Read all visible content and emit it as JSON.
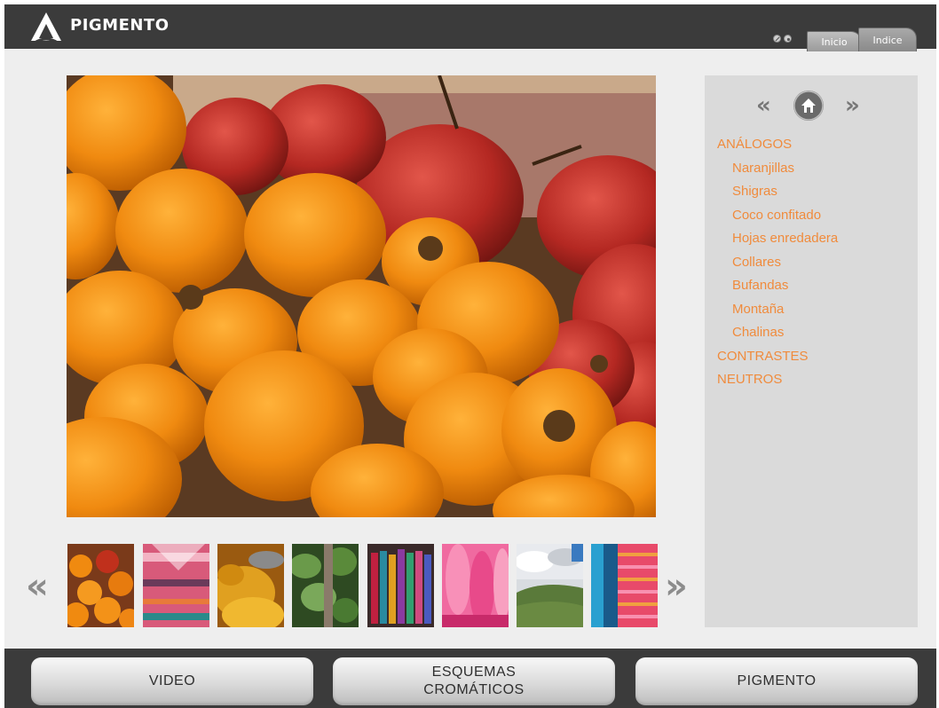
{
  "app": {
    "title": "PIGMENTO",
    "brand_color": "#f08b3c"
  },
  "header": {
    "tabs": [
      {
        "label": "Inicio"
      },
      {
        "label": "Indice"
      }
    ],
    "icons": [
      "audio-icon",
      "sound-icon"
    ]
  },
  "gallery": {
    "main_photo": "orange-fruits-photo",
    "prev_icon": "double-chevron-left-icon",
    "next_icon": "double-chevron-right-icon",
    "thumbnails": [
      "oranges-thumbnail",
      "pink-textile-thumbnail",
      "yellow-grain-thumbnail",
      "green-leaves-thumbnail",
      "hanging-yarn-thumbnail",
      "pink-yarn-thumbnail",
      "green-hills-thumbnail",
      "striped-fabric-thumbnail"
    ]
  },
  "panel": {
    "prev_icon": "double-chevron-left-icon",
    "home_icon": "home-icon",
    "next_icon": "double-chevron-right-icon",
    "menu": [
      {
        "label": "ANÁLOGOS",
        "level": 0
      },
      {
        "label": "Naranjillas",
        "level": 1
      },
      {
        "label": "Shigras",
        "level": 1
      },
      {
        "label": "Coco confitado",
        "level": 1
      },
      {
        "label": "Hojas enredadera",
        "level": 1
      },
      {
        "label": "Collares",
        "level": 1
      },
      {
        "label": "Bufandas",
        "level": 1
      },
      {
        "label": "Montaña",
        "level": 1
      },
      {
        "label": "Chalinas",
        "level": 1
      },
      {
        "label": "CONTRASTES",
        "level": 0
      },
      {
        "label": "NEUTROS",
        "level": 0
      }
    ]
  },
  "footer": {
    "buttons": [
      {
        "label": "VIDEO"
      },
      {
        "label": "ESQUEMAS\nCROMÁTICOS"
      },
      {
        "label": "PIGMENTO"
      }
    ]
  }
}
